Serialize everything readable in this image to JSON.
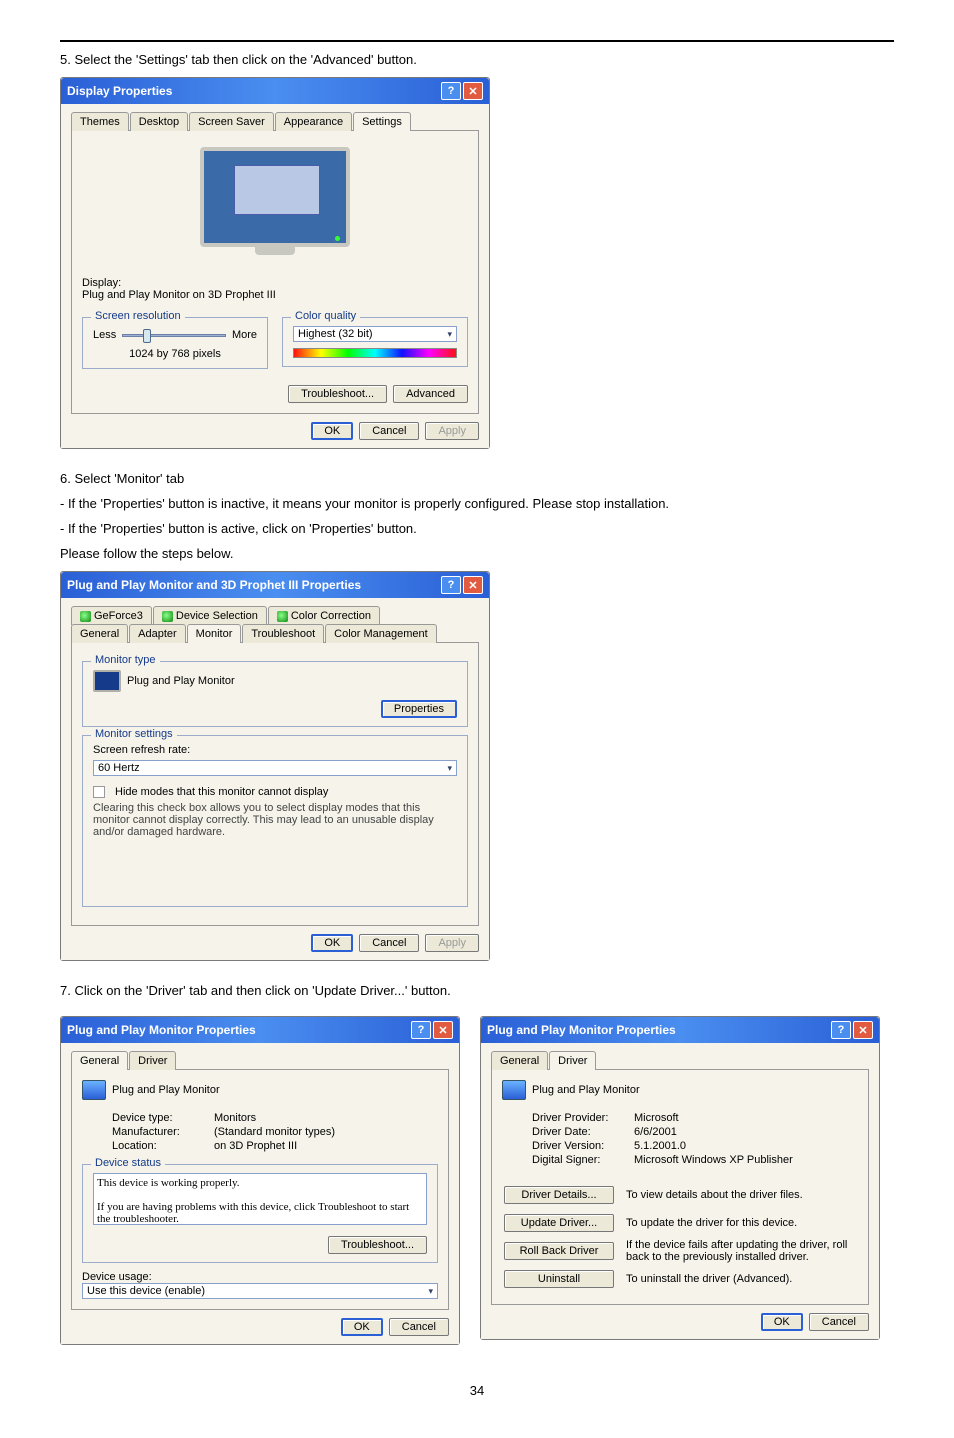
{
  "steps": {
    "s5": "5. Select the 'Settings' tab then click on the 'Advanced' button.",
    "s6a": "6. Select 'Monitor' tab",
    "s6b": "- If the 'Properties' button is inactive, it means your monitor is properly configured. Please stop installation.",
    "s6c": "- If the 'Properties' button is active, click on 'Properties' button.",
    "s6d": "Please follow the steps below.",
    "s7": "7. Click on the 'Driver' tab and then click on 'Update Driver...' button."
  },
  "dlg1": {
    "title": "Display Properties",
    "tabs": [
      "Themes",
      "Desktop",
      "Screen Saver",
      "Appearance",
      "Settings"
    ],
    "display_label": "Display:",
    "display_value": "Plug and Play Monitor on 3D Prophet III",
    "res_group": "Screen resolution",
    "less": "Less",
    "more": "More",
    "res_value": "1024 by 768 pixels",
    "color_group": "Color quality",
    "color_value": "Highest (32 bit)",
    "troubleshoot": "Troubleshoot...",
    "advanced": "Advanced",
    "ok": "OK",
    "cancel": "Cancel",
    "apply": "Apply"
  },
  "dlg2": {
    "title": "Plug and Play Monitor and 3D Prophet III Properties",
    "tabs_top": [
      "GeForce3",
      "Device Selection",
      "Color Correction"
    ],
    "tabs_bot": [
      "General",
      "Adapter",
      "Monitor",
      "Troubleshoot",
      "Color Management"
    ],
    "montype_group": "Monitor type",
    "montype_value": "Plug and Play Monitor",
    "properties": "Properties",
    "monset_group": "Monitor settings",
    "refresh_label": "Screen refresh rate:",
    "refresh_value": "60 Hertz",
    "hide_label": "Hide modes that this monitor cannot display",
    "hide_desc": "Clearing this check box allows you to select display modes that this monitor cannot display correctly. This may lead to an unusable display and/or damaged hardware.",
    "ok": "OK",
    "cancel": "Cancel",
    "apply": "Apply"
  },
  "dlg3": {
    "title": "Plug and Play Monitor Properties",
    "tabs": [
      "General",
      "Driver"
    ],
    "header": "Plug and Play Monitor",
    "devtype_l": "Device type:",
    "devtype_v": "Monitors",
    "manu_l": "Manufacturer:",
    "manu_v": "(Standard monitor types)",
    "loc_l": "Location:",
    "loc_v": "on 3D Prophet III",
    "status_group": "Device status",
    "status_text": "This device is working properly.\n\nIf you are having problems with this device, click Troubleshoot to start the troubleshooter.",
    "troubleshoot": "Troubleshoot...",
    "usage_label": "Device usage:",
    "usage_value": "Use this device (enable)",
    "ok": "OK",
    "cancel": "Cancel"
  },
  "dlg4": {
    "title": "Plug and Play Monitor Properties",
    "tabs": [
      "General",
      "Driver"
    ],
    "header": "Plug and Play Monitor",
    "prov_l": "Driver Provider:",
    "prov_v": "Microsoft",
    "date_l": "Driver Date:",
    "date_v": "6/6/2001",
    "ver_l": "Driver Version:",
    "ver_v": "5.1.2001.0",
    "sign_l": "Digital Signer:",
    "sign_v": "Microsoft Windows XP Publisher",
    "btn_details": "Driver Details...",
    "btn_details_d": "To view details about the driver files.",
    "btn_update": "Update Driver...",
    "btn_update_d": "To update the driver for this device.",
    "btn_rollback": "Roll Back Driver",
    "btn_rollback_d": "If the device fails after updating the driver, roll back to the previously installed driver.",
    "btn_uninstall": "Uninstall",
    "btn_uninstall_d": "To uninstall the driver (Advanced).",
    "ok": "OK",
    "cancel": "Cancel"
  },
  "page": "34"
}
